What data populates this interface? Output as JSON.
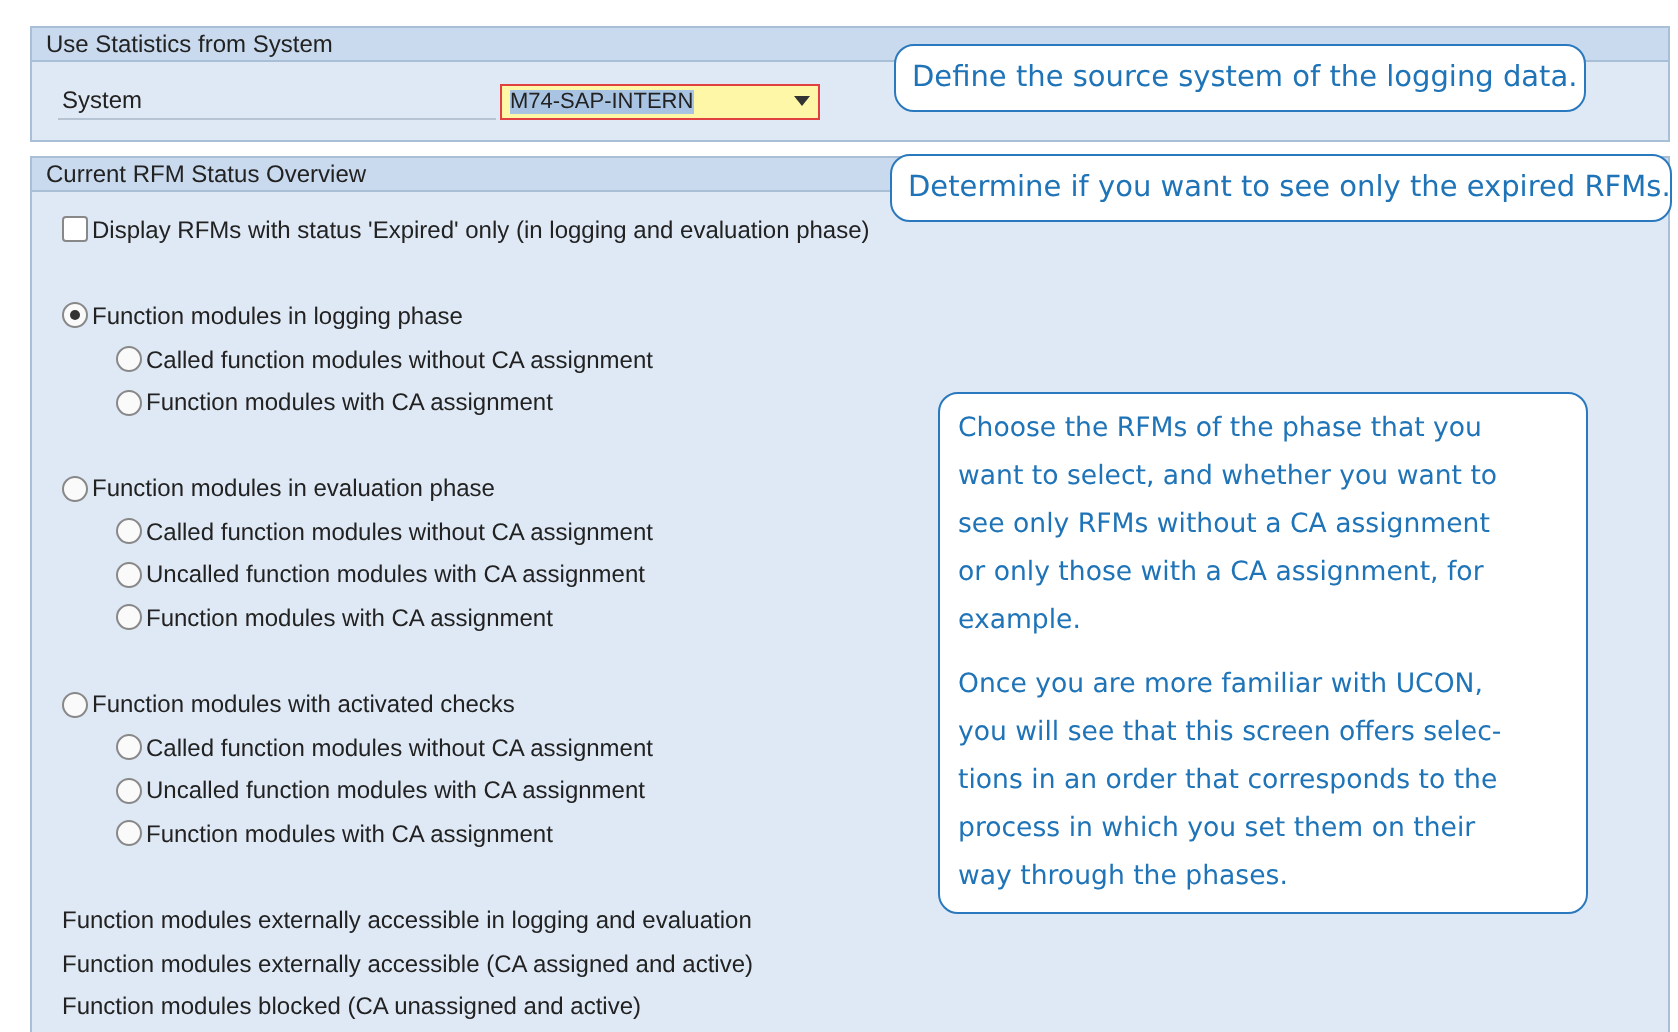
{
  "system_group": {
    "title": "Use Statistics from System",
    "field_label": "System",
    "field_value": "M74-SAP-INTERN"
  },
  "status_group": {
    "title": "Current RFM Status Overview",
    "expired_checkbox": {
      "label": "Display RFMs with status 'Expired' only (in logging and evaluation phase)",
      "checked": false
    },
    "phases": [
      {
        "label": "Function modules in logging phase",
        "selected": true,
        "options": [
          {
            "label": "Called function modules without CA assignment",
            "selected": false
          },
          {
            "label": "Function modules with CA assignment",
            "selected": false
          }
        ]
      },
      {
        "label": "Function modules in evaluation phase",
        "selected": false,
        "options": [
          {
            "label": "Called function modules without CA assignment",
            "selected": false
          },
          {
            "label": "Uncalled function modules with CA assignment",
            "selected": false
          },
          {
            "label": "Function modules with CA assignment",
            "selected": false
          }
        ]
      },
      {
        "label": "Function modules with activated checks",
        "selected": false,
        "options": [
          {
            "label": "Called function modules without CA assignment",
            "selected": false
          },
          {
            "label": "Uncalled function modules with CA assignment",
            "selected": false
          },
          {
            "label": "Function modules with CA assignment",
            "selected": false
          }
        ]
      }
    ],
    "status_lines": [
      "Function modules externally accessible in logging and evaluation",
      "Function modules externally accessible (CA assigned and active)",
      "Function modules blocked (CA unassigned and active)"
    ]
  },
  "callouts": [
    {
      "paragraphs": [
        [
          "Define the source system of the logging data."
        ]
      ]
    },
    {
      "paragraphs": [
        [
          "Determine if you want to see only the expired RFMs."
        ]
      ]
    },
    {
      "paragraphs": [
        [
          "Choose the RFMs of the phase that you",
          "want to select, and whether you want to",
          "see only RFMs without a CA assignment",
          "or only those with a CA assignment, for",
          "example."
        ],
        [
          "Once you are more familiar with UCON,",
          "you will see that this screen offers selec-",
          "tions in an order that corresponds to the",
          "process in which you set them on their",
          "way through the phases."
        ]
      ]
    }
  ]
}
